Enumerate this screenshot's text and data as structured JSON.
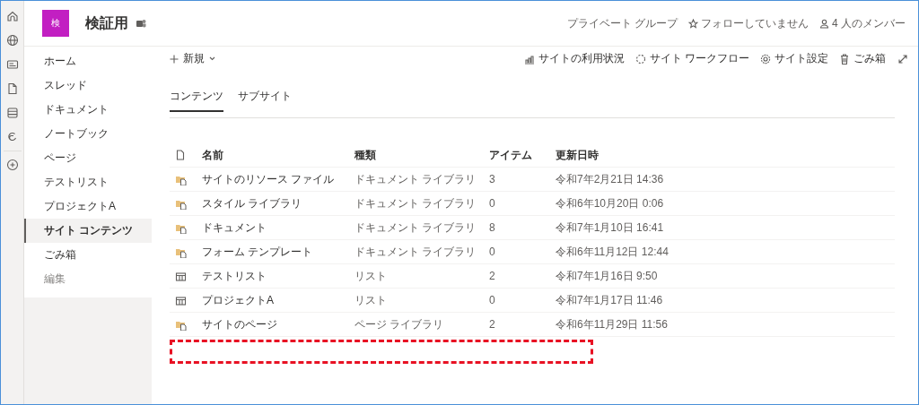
{
  "site": {
    "logo_letter": "検",
    "title": "検証用",
    "group_type": "プライベート グループ",
    "follow": "フォローしていません",
    "members": "4 人のメンバー"
  },
  "nav": [
    {
      "label": "ホーム",
      "kind": "link",
      "selected": false
    },
    {
      "label": "スレッド",
      "kind": "link",
      "selected": false
    },
    {
      "label": "ドキュメント",
      "kind": "link",
      "selected": false
    },
    {
      "label": "ノートブック",
      "kind": "link",
      "selected": false
    },
    {
      "label": "ページ",
      "kind": "link",
      "selected": false
    },
    {
      "label": "テストリスト",
      "kind": "link",
      "selected": false
    },
    {
      "label": "プロジェクトA",
      "kind": "link",
      "selected": false
    },
    {
      "label": "サイト コンテンツ",
      "kind": "link",
      "selected": true
    },
    {
      "label": "ごみ箱",
      "kind": "link",
      "selected": false
    },
    {
      "label": "編集",
      "kind": "edit",
      "selected": false
    }
  ],
  "command_bar": {
    "new": "新規",
    "actions": [
      {
        "label": "サイトの利用状況",
        "kind": "usage"
      },
      {
        "label": "サイト ワークフロー",
        "kind": "workflow"
      },
      {
        "label": "サイト設定",
        "kind": "settings"
      },
      {
        "label": "ごみ箱",
        "kind": "recycle"
      }
    ]
  },
  "tabs": [
    {
      "label": "コンテンツ",
      "selected": true
    },
    {
      "label": "サブサイト",
      "selected": false
    }
  ],
  "table": {
    "columns": [
      "名前",
      "種類",
      "アイテム",
      "更新日時"
    ],
    "rows": [
      {
        "kind": "library",
        "name": "サイトのリソース ファイル",
        "type": "ドキュメント ライブラリ",
        "items": "3",
        "modified": "令和7年2月21日 14:36"
      },
      {
        "kind": "library",
        "name": "スタイル ライブラリ",
        "type": "ドキュメント ライブラリ",
        "items": "0",
        "modified": "令和6年10月20日 0:06"
      },
      {
        "kind": "library",
        "name": "ドキュメント",
        "type": "ドキュメント ライブラリ",
        "items": "8",
        "modified": "令和7年1月10日 16:41"
      },
      {
        "kind": "library",
        "name": "フォーム テンプレート",
        "type": "ドキュメント ライブラリ",
        "items": "0",
        "modified": "令和6年11月12日 12:44"
      },
      {
        "kind": "list",
        "name": "テストリスト",
        "type": "リスト",
        "items": "2",
        "modified": "令和7年1月16日 9:50"
      },
      {
        "kind": "list",
        "name": "プロジェクトA",
        "type": "リスト",
        "items": "0",
        "modified": "令和7年1月17日 11:46"
      },
      {
        "kind": "library",
        "name": "サイトのページ",
        "type": "ページ ライブラリ",
        "items": "2",
        "modified": "令和6年11月29日 11:56"
      }
    ]
  }
}
